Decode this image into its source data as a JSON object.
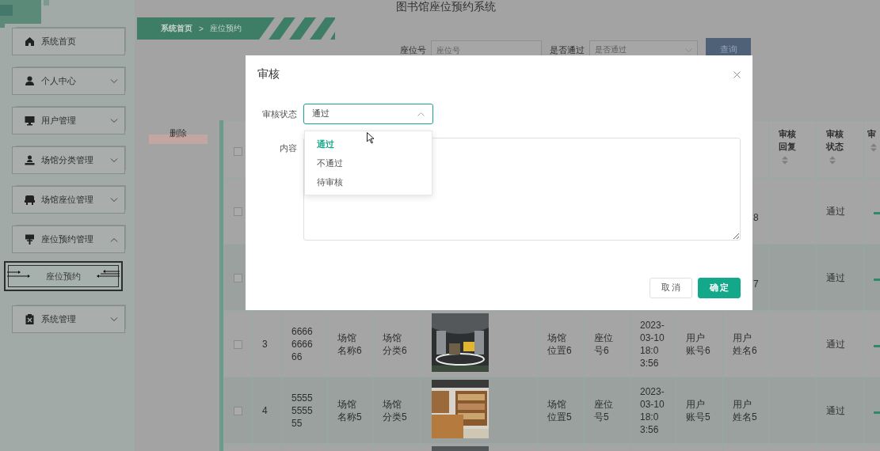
{
  "app": {
    "title": "图书馆座位预约系统"
  },
  "sidebar": {
    "items": [
      {
        "kind": "link",
        "label": "系统首页"
      },
      {
        "kind": "group",
        "label": "个人中心",
        "expanded": false
      },
      {
        "kind": "group",
        "label": "用户管理",
        "expanded": false
      },
      {
        "kind": "group",
        "label": "场馆分类管理",
        "expanded": false
      },
      {
        "kind": "group",
        "label": "场馆座位管理",
        "expanded": false
      },
      {
        "kind": "group",
        "label": "座位预约管理",
        "expanded": true,
        "children": [
          {
            "label": "座位预约",
            "selected": true
          }
        ]
      },
      {
        "kind": "group",
        "label": "系统管理",
        "expanded": false
      }
    ]
  },
  "breadcrumb": {
    "items": [
      "系统首页",
      "座位预约"
    ],
    "separator": ">"
  },
  "search": {
    "fields": [
      {
        "kind": "input",
        "label": "座位号",
        "placeholder": "座位号"
      },
      {
        "kind": "select",
        "label": "是否通过",
        "placeholder": "是否通过"
      }
    ],
    "button": "查询"
  },
  "delete_button": "删除",
  "table": {
    "header_checkbox": {
      "checked": false
    },
    "columns": [
      {
        "label": "审核回复",
        "sortable": true
      },
      {
        "label": "审核状态",
        "sortable": true
      },
      {
        "label": "审",
        "sortable": true
      }
    ],
    "rows": [
      {
        "checked": false,
        "user_name": "8",
        "status": "通过"
      },
      {
        "checked": false,
        "user_name": "7",
        "status": "通过"
      },
      {
        "checked": false,
        "index": "3",
        "code": "6666666666",
        "venue_name": "场馆名称6",
        "venue_category": "场馆分类6",
        "image": {
          "kind": "picture"
        },
        "location": "场馆位置6",
        "seat": "座位号6",
        "time": "2023-03-10 18:03:56",
        "account": "用户账号6",
        "user_name": "用户姓名6",
        "status": "通过"
      },
      {
        "checked": false,
        "index": "4",
        "code": "5555555555",
        "venue_name": "场馆名称5",
        "venue_category": "场馆分类5",
        "image": {
          "kind": "picture"
        },
        "location": "场馆位置5",
        "seat": "座位号5",
        "time": "2023-03-10 18:03:56",
        "account": "用户账号5",
        "user_name": "用户姓名5",
        "status": "通过"
      },
      {
        "image": {
          "kind": "picture"
        }
      }
    ]
  },
  "dialog": {
    "title": "审核",
    "fields": [
      {
        "kind": "select",
        "label": "审核状态",
        "value": "通过",
        "open": true,
        "options": [
          {
            "label": "通过",
            "selected": true
          },
          {
            "label": "不通过",
            "selected": false
          },
          {
            "label": "待审核",
            "selected": false
          }
        ]
      },
      {
        "kind": "textarea",
        "label": "内容"
      }
    ],
    "buttons": [
      {
        "kind": "secondary",
        "label": "取 消"
      },
      {
        "kind": "primary",
        "label": "确 定"
      }
    ]
  }
}
